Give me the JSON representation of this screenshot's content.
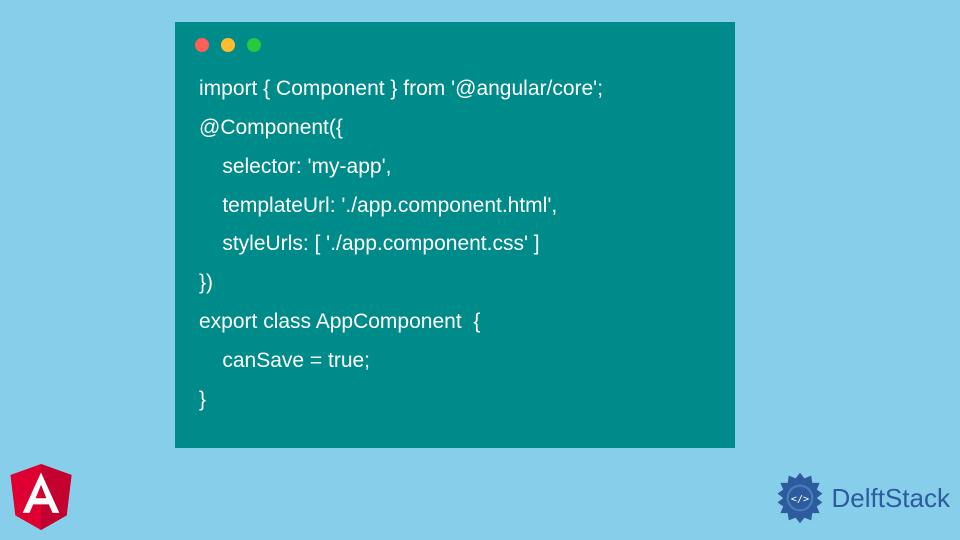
{
  "code": {
    "lines": [
      "import { Component } from '@angular/core';",
      "@Component({",
      "    selector: 'my-app',",
      "    templateUrl: './app.component.html',",
      "    styleUrls: [ './app.component.css' ]",
      "})",
      "export class AppComponent  {",
      "    canSave = true;",
      "}"
    ]
  },
  "branding": {
    "delftstack_label": "DelftStack"
  },
  "colors": {
    "background": "#87CEEB",
    "code_window": "#008B8B",
    "text": "#ffffff",
    "angular_red": "#DD0031",
    "delft_blue": "#2C5B9E"
  }
}
